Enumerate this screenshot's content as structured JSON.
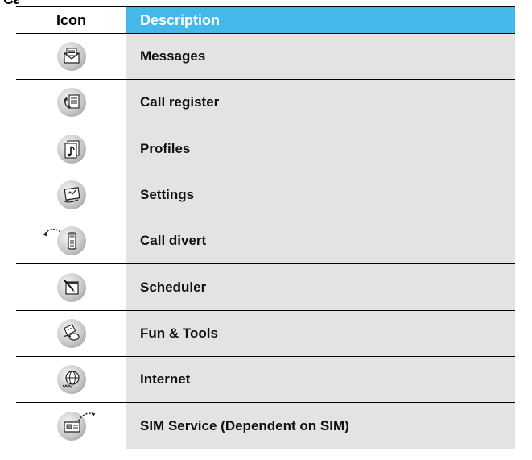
{
  "page": {
    "cut_heading": "Ca"
  },
  "table": {
    "headers": {
      "icon": "Icon",
      "description": "Description"
    },
    "header_color": "#44b8e8",
    "rows": [
      {
        "label": "Messages",
        "icon": "envelope-icon"
      },
      {
        "label": "Call register",
        "icon": "phone-list-icon"
      },
      {
        "label": "Profiles",
        "icon": "music-note-icon"
      },
      {
        "label": "Settings",
        "icon": "settings-pad-icon"
      },
      {
        "label": "Call divert",
        "icon": "phone-divert-icon"
      },
      {
        "label": "Scheduler",
        "icon": "calendar-pen-icon"
      },
      {
        "label": "Fun & Tools",
        "icon": "calculator-mouse-icon"
      },
      {
        "label": "Internet",
        "icon": "globe-www-icon"
      },
      {
        "label": "SIM Service (Dependent on SIM)",
        "icon": "sim-card-icon"
      }
    ]
  }
}
